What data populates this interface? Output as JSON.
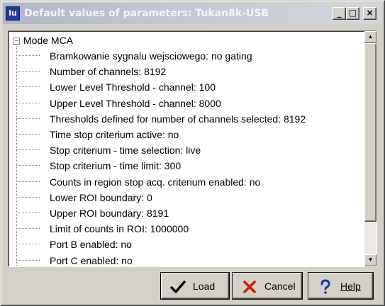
{
  "window": {
    "app_icon_text": "lu",
    "title": "Default values of parameters: Tukan8k-USB",
    "controls": {
      "minimize": "_",
      "maximize": "□",
      "close": "×"
    }
  },
  "tree": {
    "root": {
      "expander": "−",
      "label": "Mode MCA"
    },
    "items": [
      {
        "label": "Bramkowanie sygnalu wejsciowego:  no gating"
      },
      {
        "label": "Number of channels:  8192"
      },
      {
        "label": "Lower Level Threshold - channel:  100"
      },
      {
        "label": "Upper Level Threshold - channel:  8000"
      },
      {
        "label": "Thresholds defined for number of channels selected:  8192"
      },
      {
        "label": "Time stop criterium active:  no"
      },
      {
        "label": "Stop criterium - time selection:  live"
      },
      {
        "label": "Stop criterium - time limit:  300"
      },
      {
        "label": "Counts in region stop acq. criterium enabled:  no"
      },
      {
        "label": "Lower ROI boundary:  0"
      },
      {
        "label": "Upper ROI boundary:  8191"
      },
      {
        "label": "Limit of counts in ROI:  1000000"
      },
      {
        "label": "Port B enabled:  no"
      },
      {
        "label": "Port C enabled:  no"
      }
    ],
    "scrollbar": {
      "up_arrow": "▲",
      "down_arrow": "▼"
    }
  },
  "buttons": {
    "load": {
      "icon": "checkmark-icon",
      "label": "Load",
      "color": "#000000"
    },
    "cancel": {
      "icon": "x-icon",
      "label": "Cancel",
      "color": "#cc2200"
    },
    "help": {
      "icon": "question-icon",
      "label": "Help",
      "color": "#1a3aa0"
    }
  }
}
